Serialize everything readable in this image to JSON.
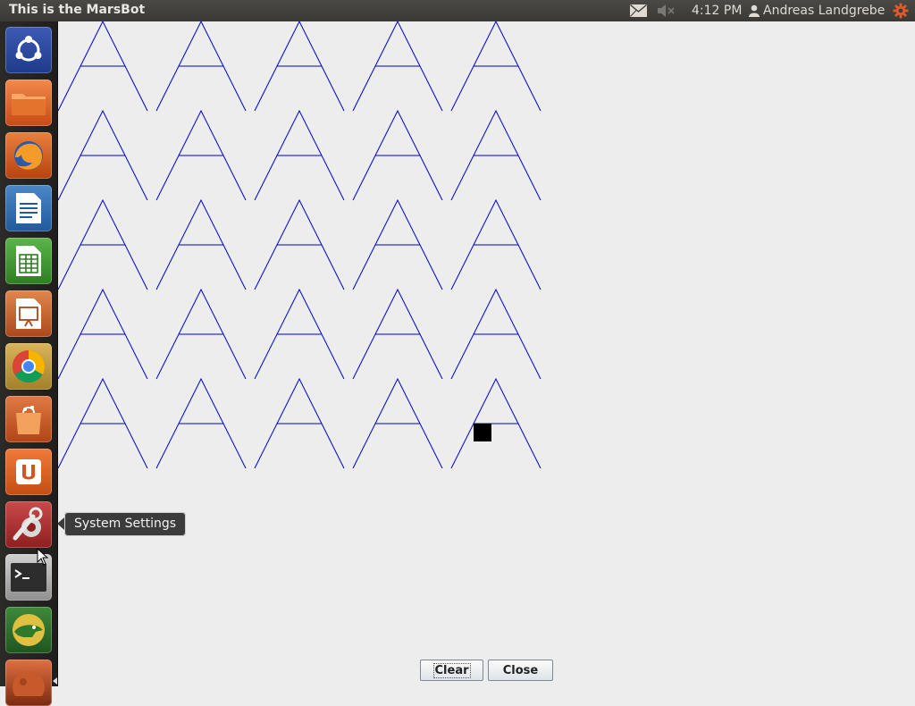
{
  "window": {
    "title": "This is the MarsBot"
  },
  "panel": {
    "clock": "4:12 PM",
    "user": "Andreas Landgrebe",
    "icons": [
      "mail-icon",
      "sound-muted-icon",
      "user-icon",
      "session-gear-icon"
    ],
    "session_color": "#e05a2b"
  },
  "launcher": {
    "items": [
      {
        "name": "ubuntu-dash",
        "icon": "ubuntu-logo-icon"
      },
      {
        "name": "files",
        "icon": "folder-icon"
      },
      {
        "name": "firefox",
        "icon": "firefox-icon"
      },
      {
        "name": "libreoffice-writer",
        "icon": "writer-icon"
      },
      {
        "name": "libreoffice-calc",
        "icon": "calc-icon"
      },
      {
        "name": "libreoffice-impress",
        "icon": "impress-icon"
      },
      {
        "name": "chrome",
        "icon": "chrome-icon"
      },
      {
        "name": "software-center",
        "icon": "shopping-bag-icon"
      },
      {
        "name": "ubuntu-one",
        "icon": "ubuntu-one-icon"
      },
      {
        "name": "system-settings",
        "icon": "settings-wrench-icon"
      },
      {
        "name": "terminal",
        "icon": "terminal-icon"
      },
      {
        "name": "gator",
        "icon": "alligator-icon"
      },
      {
        "name": "marsbot",
        "icon": "mars-icon"
      }
    ],
    "tooltip": "System Settings"
  },
  "drawing": {
    "shape": "letter-A",
    "rows": 5,
    "cols": 5,
    "stroke_color": "#0000cc",
    "robot_color": "#000000"
  },
  "buttons": {
    "clear": "Clear",
    "close": "Close"
  }
}
